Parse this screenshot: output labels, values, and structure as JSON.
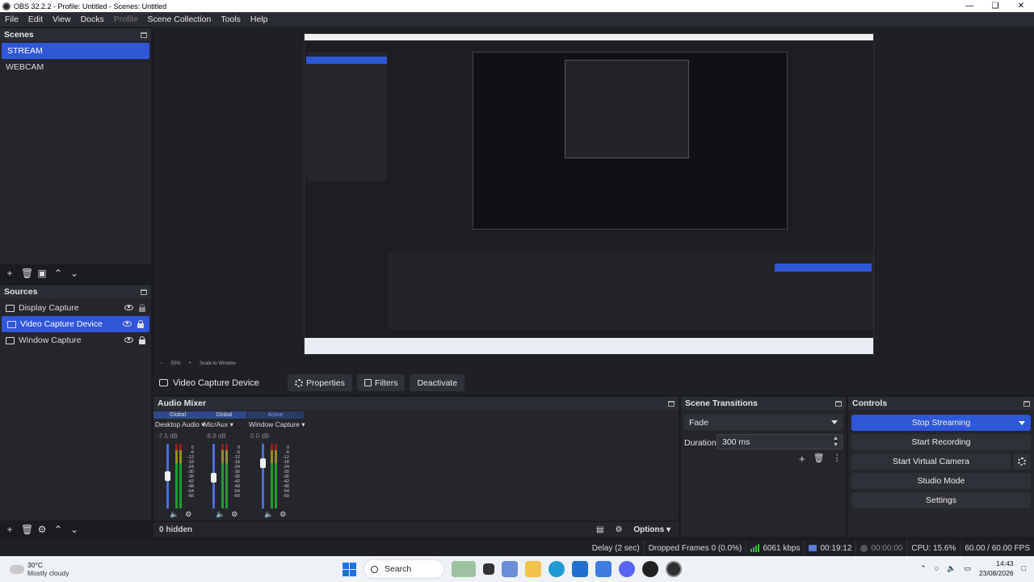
{
  "window": {
    "title": "OBS 32.2.2 - Profile: Untitled - Scenes: Untitled"
  },
  "menu": [
    "File",
    "Edit",
    "View",
    "Docks",
    "Profile",
    "Scene Collection",
    "Tools",
    "Help"
  ],
  "scenes": {
    "title": "Scenes",
    "items": [
      "STREAM",
      "WEBCAM"
    ],
    "selected": "STREAM"
  },
  "sources": {
    "title": "Sources",
    "items": [
      "Display Capture",
      "Video Capture Device",
      "Window Capture"
    ],
    "selected": "Video Capture Device"
  },
  "preview": {
    "zoom": "55%",
    "scale_mode": "Scale to Window"
  },
  "source_bar": {
    "name": "Video Capture Device",
    "properties": "Properties",
    "filters": "Filters",
    "deactivate": "Deactivate"
  },
  "mixer": {
    "title": "Audio Mixer",
    "channels": [
      {
        "header": "Global",
        "name": "Desktop Audio",
        "db": "-7.5 dB",
        "active": false
      },
      {
        "header": "Global",
        "name": "Mic/Aux",
        "db": "-8.8 dB",
        "active": false
      },
      {
        "header": "Active",
        "name": "Window Capture",
        "db": "0.0 dB",
        "active": true
      }
    ],
    "tick_labels": [
      "0",
      "-6",
      "-12",
      "-18",
      "-24",
      "-30",
      "-36",
      "-42",
      "-48",
      "-54",
      "-60"
    ],
    "hidden": "0 hidden",
    "options": "Options"
  },
  "transitions": {
    "title": "Scene Transitions",
    "selected": "Fade",
    "duration_label": "Duration",
    "duration_value": "300 ms"
  },
  "controls": {
    "title": "Controls",
    "stop_streaming": "Stop Streaming",
    "start_recording": "Start Recording",
    "start_virtual_camera": "Start Virtual Camera",
    "studio_mode": "Studio Mode",
    "settings": "Settings"
  },
  "status": {
    "delay": "Delay (2 sec)",
    "dropped": "Dropped Frames 0 (0.0%)",
    "bitrate": "6061 kbps",
    "stream_time": "00:19:12",
    "rec_time": "00:00:00",
    "cpu": "CPU: 15.6%",
    "fps": "60.00 / 60.00 FPS"
  },
  "taskbar": {
    "temp": "30°C",
    "weather": "Mostly cloudy",
    "search": "Search",
    "time": "14:43",
    "date": "23/08/2026"
  },
  "colors": {
    "accent": "#2e57d9",
    "panel": "#24262c",
    "background": "#1a1c21"
  }
}
